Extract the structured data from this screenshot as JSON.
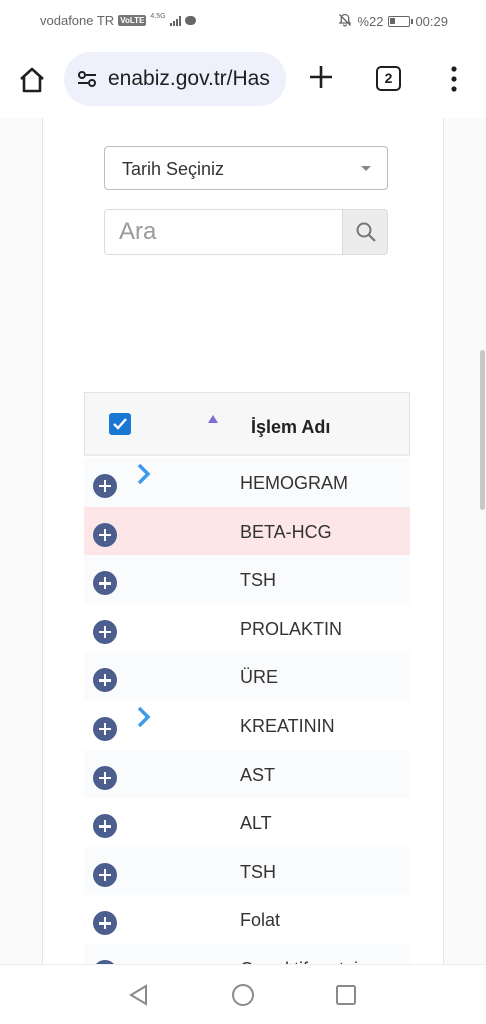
{
  "status": {
    "carrier": "vodafone TR",
    "volte": "VoLTE",
    "network": "4.5G",
    "battery": "%22",
    "time": "00:29"
  },
  "browser": {
    "url": "enabiz.gov.tr/Has",
    "tab_count": "2"
  },
  "filters": {
    "date_select": "Tarih Seçiniz",
    "search_placeholder": "Ara"
  },
  "table": {
    "header": "İşlem Adı",
    "rows": [
      {
        "name": "HEMOGRAM",
        "expandable": true,
        "highlight": false
      },
      {
        "name": "BETA-HCG",
        "expandable": false,
        "highlight": true
      },
      {
        "name": "TSH",
        "expandable": false,
        "highlight": false
      },
      {
        "name": "PROLAKTIN",
        "expandable": false,
        "highlight": false
      },
      {
        "name": "ÜRE",
        "expandable": false,
        "highlight": false
      },
      {
        "name": "KREATININ",
        "expandable": true,
        "highlight": false
      },
      {
        "name": "AST",
        "expandable": false,
        "highlight": false
      },
      {
        "name": "ALT",
        "expandable": false,
        "highlight": false
      },
      {
        "name": "TSH",
        "expandable": false,
        "highlight": false
      },
      {
        "name": "Folat",
        "expandable": false,
        "highlight": false
      },
      {
        "name": "C-reaktif protein",
        "expandable": false,
        "highlight": false
      }
    ]
  },
  "colors": {
    "accent": "#1976d2",
    "expand_button": "#4b5e8e",
    "chevron": "#3d9be9",
    "highlight_row": "#fde6e8",
    "sort_arrow": "#7b6fd6"
  }
}
